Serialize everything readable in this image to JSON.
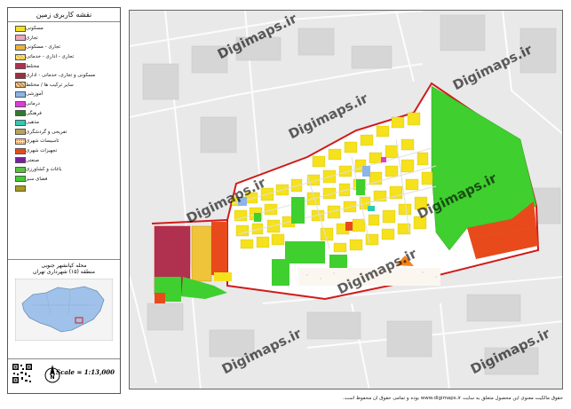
{
  "legend": {
    "title": "نقشه کاربری زمین",
    "items": [
      {
        "label": "مسکونی",
        "color": "#f5e11c",
        "pattern": "solid"
      },
      {
        "label": "تجاری",
        "color": "#f2a5b8",
        "pattern": "solid"
      },
      {
        "label": "تجاری - مسکونی",
        "color": "#e8b23c",
        "pattern": "solid"
      },
      {
        "label": "تجاری - اداری - خدماتی",
        "color": "#f0c43a",
        "pattern": "hatch"
      },
      {
        "label": "مختلط",
        "color": "#b03050",
        "pattern": "solid"
      },
      {
        "label": "مسکونی و تجاری، خدماتی - اداری",
        "color": "#9c2f3f",
        "pattern": "solid"
      },
      {
        "label": "سایر ترکیب ها / مختلط",
        "color": "#d28a45",
        "pattern": "hatch"
      },
      {
        "label": "آموزشی",
        "color": "#8cb4e8",
        "pattern": "solid"
      },
      {
        "label": "درمانی",
        "color": "#e23ad6",
        "pattern": "solid"
      },
      {
        "label": "فرهنگی",
        "color": "#2f7a2c",
        "pattern": "solid"
      },
      {
        "label": "مذهبی",
        "color": "#2fc9b4",
        "pattern": "solid"
      },
      {
        "label": "تفریحی و گردشگری",
        "color": "#b7a35a",
        "pattern": "solid"
      },
      {
        "label": "تاسیسات شهری",
        "color": "#f6811a",
        "pattern": "dots"
      },
      {
        "label": "تجهیزات شهری",
        "color": "#e84a1c",
        "pattern": "solid"
      },
      {
        "label": "صنعتی",
        "color": "#7a1ea0",
        "pattern": "solid"
      },
      {
        "label": "باغات و کشاورزی",
        "color": "#58c23a",
        "pattern": "solid"
      },
      {
        "label": "فضای سبز",
        "color": "#3fcf2e",
        "pattern": "solid"
      },
      {
        "label": "",
        "color": "#a69a1c",
        "pattern": "solid"
      }
    ]
  },
  "area": {
    "name": "محله کیانشهر جنوبی",
    "district": "منطقه (۱۵) شهرداری تهران"
  },
  "scale": "Scale = 1:13,000",
  "watermark": "Digimaps.ir",
  "footer": "حقوق مالکیت معنوی این محصول متعلق به سایت www.digimaps.ir بوده و تمامی حقوق آن محفوظ است.",
  "colors": {
    "residential": "#f5e11c",
    "green_space": "#3fcf2e",
    "utility": "#e84a1c",
    "mixed": "#b03050",
    "education": "#8cb4e8",
    "boundary": "#d11a1a",
    "background_map": "#e9e9e9",
    "inset_area": "#9fc1ea"
  }
}
